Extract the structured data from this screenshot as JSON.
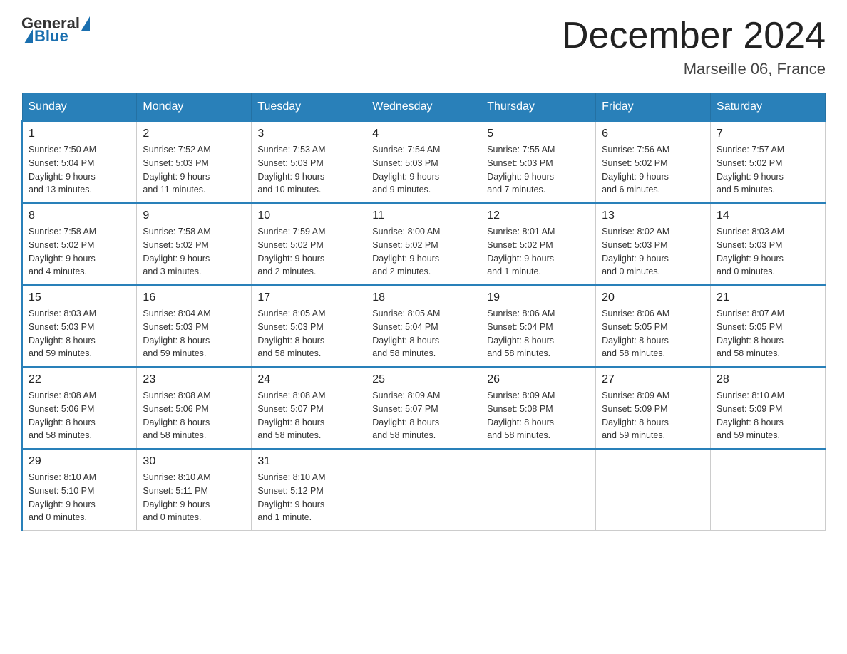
{
  "logo": {
    "general": "General",
    "blue": "Blue"
  },
  "header": {
    "title": "December 2024",
    "subtitle": "Marseille 06, France"
  },
  "days_of_week": [
    "Sunday",
    "Monday",
    "Tuesday",
    "Wednesday",
    "Thursday",
    "Friday",
    "Saturday"
  ],
  "weeks": [
    [
      {
        "day": "1",
        "info": "Sunrise: 7:50 AM\nSunset: 5:04 PM\nDaylight: 9 hours\nand 13 minutes."
      },
      {
        "day": "2",
        "info": "Sunrise: 7:52 AM\nSunset: 5:03 PM\nDaylight: 9 hours\nand 11 minutes."
      },
      {
        "day": "3",
        "info": "Sunrise: 7:53 AM\nSunset: 5:03 PM\nDaylight: 9 hours\nand 10 minutes."
      },
      {
        "day": "4",
        "info": "Sunrise: 7:54 AM\nSunset: 5:03 PM\nDaylight: 9 hours\nand 9 minutes."
      },
      {
        "day": "5",
        "info": "Sunrise: 7:55 AM\nSunset: 5:03 PM\nDaylight: 9 hours\nand 7 minutes."
      },
      {
        "day": "6",
        "info": "Sunrise: 7:56 AM\nSunset: 5:02 PM\nDaylight: 9 hours\nand 6 minutes."
      },
      {
        "day": "7",
        "info": "Sunrise: 7:57 AM\nSunset: 5:02 PM\nDaylight: 9 hours\nand 5 minutes."
      }
    ],
    [
      {
        "day": "8",
        "info": "Sunrise: 7:58 AM\nSunset: 5:02 PM\nDaylight: 9 hours\nand 4 minutes."
      },
      {
        "day": "9",
        "info": "Sunrise: 7:58 AM\nSunset: 5:02 PM\nDaylight: 9 hours\nand 3 minutes."
      },
      {
        "day": "10",
        "info": "Sunrise: 7:59 AM\nSunset: 5:02 PM\nDaylight: 9 hours\nand 2 minutes."
      },
      {
        "day": "11",
        "info": "Sunrise: 8:00 AM\nSunset: 5:02 PM\nDaylight: 9 hours\nand 2 minutes."
      },
      {
        "day": "12",
        "info": "Sunrise: 8:01 AM\nSunset: 5:02 PM\nDaylight: 9 hours\nand 1 minute."
      },
      {
        "day": "13",
        "info": "Sunrise: 8:02 AM\nSunset: 5:03 PM\nDaylight: 9 hours\nand 0 minutes."
      },
      {
        "day": "14",
        "info": "Sunrise: 8:03 AM\nSunset: 5:03 PM\nDaylight: 9 hours\nand 0 minutes."
      }
    ],
    [
      {
        "day": "15",
        "info": "Sunrise: 8:03 AM\nSunset: 5:03 PM\nDaylight: 8 hours\nand 59 minutes."
      },
      {
        "day": "16",
        "info": "Sunrise: 8:04 AM\nSunset: 5:03 PM\nDaylight: 8 hours\nand 59 minutes."
      },
      {
        "day": "17",
        "info": "Sunrise: 8:05 AM\nSunset: 5:03 PM\nDaylight: 8 hours\nand 58 minutes."
      },
      {
        "day": "18",
        "info": "Sunrise: 8:05 AM\nSunset: 5:04 PM\nDaylight: 8 hours\nand 58 minutes."
      },
      {
        "day": "19",
        "info": "Sunrise: 8:06 AM\nSunset: 5:04 PM\nDaylight: 8 hours\nand 58 minutes."
      },
      {
        "day": "20",
        "info": "Sunrise: 8:06 AM\nSunset: 5:05 PM\nDaylight: 8 hours\nand 58 minutes."
      },
      {
        "day": "21",
        "info": "Sunrise: 8:07 AM\nSunset: 5:05 PM\nDaylight: 8 hours\nand 58 minutes."
      }
    ],
    [
      {
        "day": "22",
        "info": "Sunrise: 8:08 AM\nSunset: 5:06 PM\nDaylight: 8 hours\nand 58 minutes."
      },
      {
        "day": "23",
        "info": "Sunrise: 8:08 AM\nSunset: 5:06 PM\nDaylight: 8 hours\nand 58 minutes."
      },
      {
        "day": "24",
        "info": "Sunrise: 8:08 AM\nSunset: 5:07 PM\nDaylight: 8 hours\nand 58 minutes."
      },
      {
        "day": "25",
        "info": "Sunrise: 8:09 AM\nSunset: 5:07 PM\nDaylight: 8 hours\nand 58 minutes."
      },
      {
        "day": "26",
        "info": "Sunrise: 8:09 AM\nSunset: 5:08 PM\nDaylight: 8 hours\nand 58 minutes."
      },
      {
        "day": "27",
        "info": "Sunrise: 8:09 AM\nSunset: 5:09 PM\nDaylight: 8 hours\nand 59 minutes."
      },
      {
        "day": "28",
        "info": "Sunrise: 8:10 AM\nSunset: 5:09 PM\nDaylight: 8 hours\nand 59 minutes."
      }
    ],
    [
      {
        "day": "29",
        "info": "Sunrise: 8:10 AM\nSunset: 5:10 PM\nDaylight: 9 hours\nand 0 minutes."
      },
      {
        "day": "30",
        "info": "Sunrise: 8:10 AM\nSunset: 5:11 PM\nDaylight: 9 hours\nand 0 minutes."
      },
      {
        "day": "31",
        "info": "Sunrise: 8:10 AM\nSunset: 5:12 PM\nDaylight: 9 hours\nand 1 minute."
      },
      {
        "day": "",
        "info": ""
      },
      {
        "day": "",
        "info": ""
      },
      {
        "day": "",
        "info": ""
      },
      {
        "day": "",
        "info": ""
      }
    ]
  ]
}
